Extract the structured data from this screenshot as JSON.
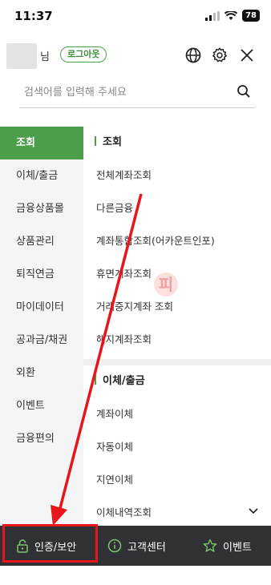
{
  "status_bar": {
    "time": "11:37",
    "battery": "78"
  },
  "header": {
    "user_name": "님",
    "logout_label": "로그아웃"
  },
  "search": {
    "placeholder": "검색어를 입력해 주세요"
  },
  "sidebar": {
    "items": [
      {
        "label": "조회",
        "active": true
      },
      {
        "label": "이체/출금"
      },
      {
        "label": "금융상품몰"
      },
      {
        "label": "상품관리"
      },
      {
        "label": "퇴직연금"
      },
      {
        "label": "마이데이터"
      },
      {
        "label": "공과금/채권"
      },
      {
        "label": "외환"
      },
      {
        "label": "이벤트"
      },
      {
        "label": "금융편의"
      }
    ]
  },
  "content": {
    "sections": [
      {
        "title": "조회",
        "items": [
          "전체계좌조회",
          "다른금융",
          "계좌통합조회(어카운트인포)",
          "휴면계좌조회",
          "거래중지계좌 조회",
          "해지계좌조회"
        ]
      },
      {
        "title": "이체/출금",
        "items": [
          "계좌이체",
          "자동이체",
          "지연이체",
          "이체내역조회"
        ]
      }
    ]
  },
  "bottom_bar": {
    "items": [
      {
        "label": "인증/보안",
        "icon": "lock-icon"
      },
      {
        "label": "고객센터",
        "icon": "info-icon"
      },
      {
        "label": "이벤트",
        "icon": "star-icon"
      }
    ]
  },
  "colors": {
    "accent": "#4c9e4a",
    "annotation": "#e8161b",
    "bottom_bar": "#2f3134"
  }
}
